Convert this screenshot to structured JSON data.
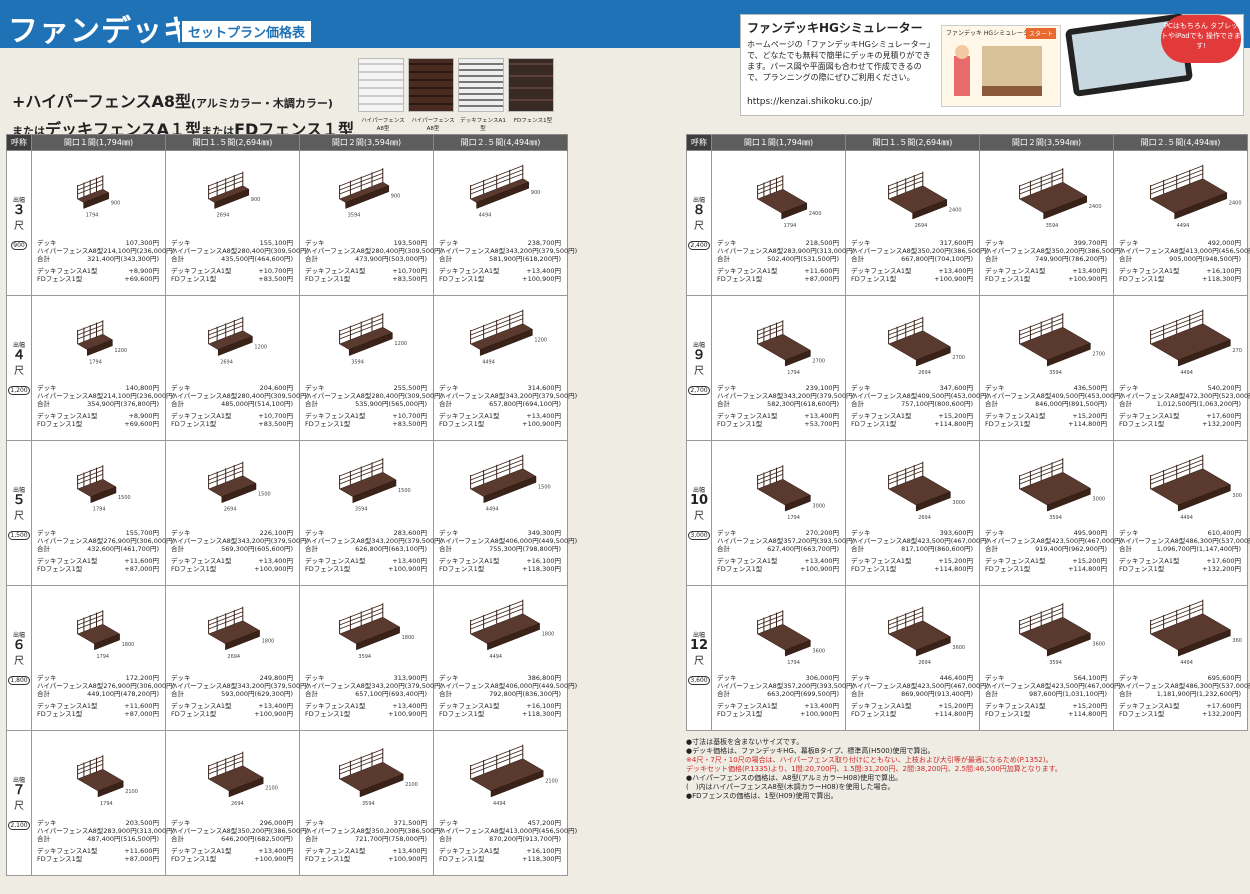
{
  "header": {
    "brand": "ファンデッキ",
    "subtitle": "セットプラン価格表"
  },
  "simulator": {
    "title": "ファンデッキHGシミュレーター",
    "text": "ホームページの「ファンデッキHGシミュレーター」で、どなたでも無料で簡単にデッキの見積りができます。パース図や平面図も合わせて作成できるので、プランニングの際にぜひご利用ください。",
    "url": "https://kenzai.shikoku.co.jp/",
    "shot_title": "ファンデッキ HGシミュレーター",
    "shot_button": "スタート",
    "badge": "PCはもちろん タブレットやiPadでも 操作できます!"
  },
  "product": {
    "line1": "+ハイパーフェンスA8型",
    "line1_sub": "(アルミカラー・木調カラー)",
    "line2_pre": "または",
    "line2": "デッキフェンスA１型",
    "line2_mid": "または",
    "line2_end": "FDフェンス１型"
  },
  "fence_captions": [
    "ハイパーフェンスA8型",
    "ハイパーフェンスA8型",
    "デッキフェンスA1型",
    "FDフェンス1型"
  ],
  "table": {
    "corner": "呼称",
    "columns": [
      "間口１間(1,794㎜)",
      "間口１.５間(2,694㎜)",
      "間口２間(3,594㎜)",
      "間口２.５間(4,494㎜)"
    ],
    "labels": {
      "deck": "デッキ",
      "hyper": "ハイパーフェンスA8型",
      "total": "合計",
      "dfa1": "デッキフェンスA1型",
      "fd1": "FDフェンス1型"
    }
  },
  "left_rows": [
    {
      "top": "出幅",
      "num": "３",
      "shaku": "尺",
      "mm": "900",
      "depth": "900",
      "cells": [
        {
          "w": "1794",
          "deck": "107,300円",
          "hyper": "214,100円(236,000円)",
          "total": "321,400円(343,300円)",
          "dfa1": "+8,900円",
          "fd1": "+69,600円"
        },
        {
          "w": "2694",
          "deck": "155,100円",
          "hyper": "280,400円(309,500円)",
          "total": "435,500円(464,600円)",
          "dfa1": "+10,700円",
          "fd1": "+83,500円"
        },
        {
          "w": "3594",
          "deck": "193,500円",
          "hyper": "280,400円(309,500円)",
          "total": "473,900円(503,000円)",
          "dfa1": "+10,700円",
          "fd1": "+83,500円"
        },
        {
          "w": "4494",
          "deck": "238,700円",
          "hyper": "343,200円(379,500円)",
          "total": "581,900円(618,200円)",
          "dfa1": "+13,400円",
          "fd1": "+100,900円"
        }
      ]
    },
    {
      "top": "出幅",
      "num": "４",
      "shaku": "尺",
      "mm": "1,200",
      "depth": "1200",
      "cells": [
        {
          "w": "1794",
          "deck": "140,800円",
          "hyper": "214,100円(236,000円)",
          "total": "354,900円(376,800円)",
          "dfa1": "+8,900円",
          "fd1": "+69,600円"
        },
        {
          "w": "2694",
          "deck": "204,600円",
          "hyper": "280,400円(309,500円)",
          "total": "485,000円(514,100円)",
          "dfa1": "+10,700円",
          "fd1": "+83,500円"
        },
        {
          "w": "3594",
          "deck": "255,500円",
          "hyper": "280,400円(309,500円)",
          "total": "535,900円(565,000円)",
          "dfa1": "+10,700円",
          "fd1": "+83,500円"
        },
        {
          "w": "4494",
          "deck": "314,600円",
          "hyper": "343,200円(379,500円)",
          "total": "657,800円(694,100円)",
          "dfa1": "+13,400円",
          "fd1": "+100,900円"
        }
      ]
    },
    {
      "top": "出幅",
      "num": "５",
      "shaku": "尺",
      "mm": "1,500",
      "depth": "1500",
      "cells": [
        {
          "w": "1794",
          "deck": "155,700円",
          "hyper": "276,900円(306,000円)",
          "total": "432,600円(461,700円)",
          "dfa1": "+11,600円",
          "fd1": "+87,000円"
        },
        {
          "w": "2694",
          "deck": "226,100円",
          "hyper": "343,200円(379,500円)",
          "total": "569,300円(605,600円)",
          "dfa1": "+13,400円",
          "fd1": "+100,900円"
        },
        {
          "w": "3594",
          "deck": "283,600円",
          "hyper": "343,200円(379,500円)",
          "total": "626,800円(663,100円)",
          "dfa1": "+13,400円",
          "fd1": "+100,900円"
        },
        {
          "w": "4494",
          "deck": "349,300円",
          "hyper": "406,000円(449,500円)",
          "total": "755,300円(798,800円)",
          "dfa1": "+16,100円",
          "fd1": "+118,300円"
        }
      ]
    },
    {
      "top": "出幅",
      "num": "６",
      "shaku": "尺",
      "mm": "1,800",
      "depth": "1800",
      "cells": [
        {
          "w": "1794",
          "deck": "172,200円",
          "hyper": "276,900円(306,000円)",
          "total": "449,100円(478,200円)",
          "dfa1": "+11,600円",
          "fd1": "+87,000円"
        },
        {
          "w": "2694",
          "deck": "249,800円",
          "hyper": "343,200円(379,500円)",
          "total": "593,000円(629,300円)",
          "dfa1": "+13,400円",
          "fd1": "+100,900円"
        },
        {
          "w": "3594",
          "deck": "313,900円",
          "hyper": "343,200円(379,500円)",
          "total": "657,100円(693,400円)",
          "dfa1": "+13,400円",
          "fd1": "+100,900円"
        },
        {
          "w": "4494",
          "deck": "386,800円",
          "hyper": "406,000円(449,500円)",
          "total": "792,800円(836,300円)",
          "dfa1": "+16,100円",
          "fd1": "+118,300円"
        }
      ]
    },
    {
      "top": "出幅",
      "num": "７",
      "shaku": "尺",
      "mm": "2,100",
      "depth": "2100",
      "cells": [
        {
          "w": "1794",
          "deck": "203,500円",
          "hyper": "283,900円(313,000円)",
          "total": "487,400円(516,500円)",
          "dfa1": "+11,600円",
          "fd1": "+87,000円"
        },
        {
          "w": "2694",
          "deck": "296,000円",
          "hyper": "350,200円(386,500円)",
          "total": "646,200円(682,500円)",
          "dfa1": "+13,400円",
          "fd1": "+100,900円"
        },
        {
          "w": "3594",
          "deck": "371,500円",
          "hyper": "350,200円(386,500円)",
          "total": "721,700円(758,000円)",
          "dfa1": "+13,400円",
          "fd1": "+100,900円"
        },
        {
          "w": "4494",
          "deck": "457,200円",
          "hyper": "413,000円(456,500円)",
          "total": "870,200円(913,700円)",
          "dfa1": "+16,100円",
          "fd1": "+118,300円"
        }
      ]
    }
  ],
  "right_rows": [
    {
      "top": "出幅",
      "num": "８",
      "shaku": "尺",
      "mm": "2,400",
      "depth": "2400",
      "cells": [
        {
          "w": "1794",
          "deck": "218,500円",
          "hyper": "283,900円(313,000円)",
          "total": "502,400円(531,500円)",
          "dfa1": "+11,600円",
          "fd1": "+87,000円"
        },
        {
          "w": "2694",
          "deck": "317,600円",
          "hyper": "350,200円(386,500円)",
          "total": "667,800円(704,100円)",
          "dfa1": "+13,400円",
          "fd1": "+100,900円"
        },
        {
          "w": "3594",
          "deck": "399,700円",
          "hyper": "350,200円(386,500円)",
          "total": "749,900円(786,200円)",
          "dfa1": "+13,400円",
          "fd1": "+100,900円"
        },
        {
          "w": "4494",
          "deck": "492,000円",
          "hyper": "413,000円(456,500円)",
          "total": "905,000円(948,500円)",
          "dfa1": "+16,100円",
          "fd1": "+118,300円"
        }
      ]
    },
    {
      "top": "出幅",
      "num": "９",
      "shaku": "尺",
      "mm": "2,700",
      "depth": "2700",
      "cells": [
        {
          "w": "1794",
          "deck": "239,100円",
          "hyper": "343,200円(379,500円)",
          "total": "582,300円(618,600円)",
          "dfa1": "+13,400円",
          "fd1": "+53,700円"
        },
        {
          "w": "2694",
          "deck": "347,600円",
          "hyper": "409,500円(453,000円)",
          "total": "757,100円(800,600円)",
          "dfa1": "+15,200円",
          "fd1": "+114,800円"
        },
        {
          "w": "3594",
          "deck": "436,500円",
          "hyper": "409,500円(453,000円)",
          "total": "846,000円(891,500円)",
          "dfa1": "+15,200円",
          "fd1": "+114,800円"
        },
        {
          "w": "4494",
          "deck": "540,200円",
          "hyper": "472,300円(523,000円)",
          "total": "1,012,500円(1,063,200円)",
          "dfa1": "+17,600円",
          "fd1": "+132,200円"
        }
      ]
    },
    {
      "top": "出幅",
      "num": "10",
      "shaku": "尺",
      "mm": "3,000",
      "depth": "3000",
      "cells": [
        {
          "w": "1794",
          "deck": "270,200円",
          "hyper": "357,200円(393,500円)",
          "total": "627,400円(663,700円)",
          "dfa1": "+13,400円",
          "fd1": "+100,900円"
        },
        {
          "w": "2694",
          "deck": "393,600円",
          "hyper": "423,500円(467,000円)",
          "total": "817,100円(860,600円)",
          "dfa1": "+15,200円",
          "fd1": "+114,800円"
        },
        {
          "w": "3594",
          "deck": "495,900円",
          "hyper": "423,500円(467,000円)",
          "total": "919,400円(962,900円)",
          "dfa1": "+15,200円",
          "fd1": "+114,800円"
        },
        {
          "w": "4494",
          "deck": "610,400円",
          "hyper": "486,300円(537,000円)",
          "total": "1,096,700円(1,147,400円)",
          "dfa1": "+17,600円",
          "fd1": "+132,200円"
        }
      ]
    },
    {
      "top": "出幅",
      "num": "12",
      "shaku": "尺",
      "mm": "3,600",
      "depth": "3600",
      "cells": [
        {
          "w": "1794",
          "deck": "306,000円",
          "hyper": "357,200円(393,500円)",
          "total": "663,200円(699,500円)",
          "dfa1": "+13,400円",
          "fd1": "+100,900円"
        },
        {
          "w": "2694",
          "deck": "446,400円",
          "hyper": "423,500円(467,000円)",
          "total": "869,900円(913,400円)",
          "dfa1": "+15,200円",
          "fd1": "+114,800円"
        },
        {
          "w": "3594",
          "deck": "564,100円",
          "hyper": "423,500円(467,000円)",
          "total": "987,600円(1,031,100円)",
          "dfa1": "+15,200円",
          "fd1": "+114,800円"
        },
        {
          "w": "4494",
          "deck": "695,600円",
          "hyper": "486,300円(537,000円)",
          "total": "1,181,900円(1,232,600円)",
          "dfa1": "+17,600円",
          "fd1": "+132,200円"
        }
      ]
    }
  ],
  "notes": [
    {
      "text": "●寸法は基板を含まないサイズです。",
      "red": false
    },
    {
      "text": "●デッキ価格は、ファンデッキHG、幕板Bタイプ、標準高(H500)使用で算出。",
      "red": false
    },
    {
      "text": "※4尺・7尺・10尺の場合は、ハイパーフェンス取り付けにともない、上枝および大引等が最適になるため(P.1352)。",
      "red": true
    },
    {
      "text": "デッキセット価格(P.1335)より、1間:20,700円、1.5間:31,200円、2間:38,200円、2.5間:46,500円加算となります。",
      "red": true
    },
    {
      "text": "●ハイパーフェンスの価格は、A8型(アルミカラーH08)使用で算出。",
      "red": false
    },
    {
      "text": "(　)内はハイパーフェンスA8型(木調カラーH08)を使用した場合。",
      "red": false
    },
    {
      "text": "●FDフェンスの価格は、1型(H09)使用で算出。",
      "red": false
    }
  ]
}
